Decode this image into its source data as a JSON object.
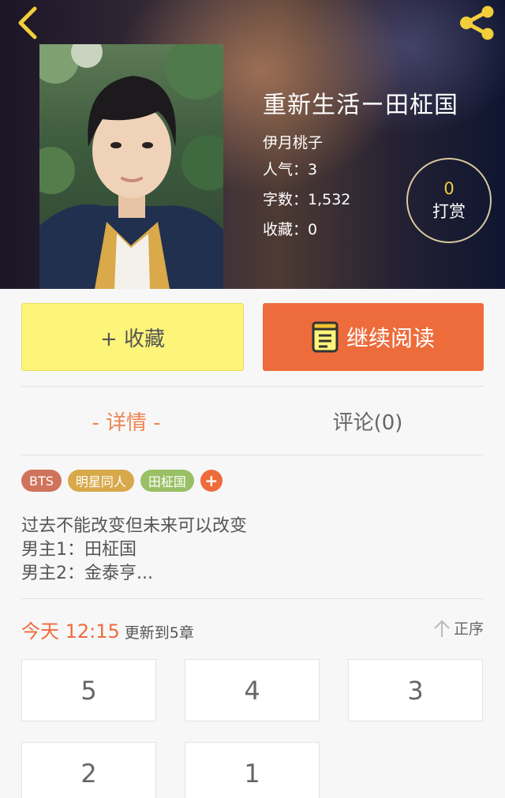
{
  "header": {
    "back_icon": "chevron-left-icon",
    "share_icon": "share-icon",
    "accent_color": "#f2cf3a"
  },
  "book": {
    "title": "重新生活ー田柾国",
    "author": "伊月桃子",
    "popularity": "人气：3",
    "word_count": "字数：1,532",
    "favorites": "收藏：0"
  },
  "reward": {
    "count": "0",
    "label": "打赏"
  },
  "actions": {
    "collect_label": "+ 收藏",
    "read_label": "继续阅读",
    "read_icon": "book-icon"
  },
  "tabs": {
    "details": "- 详情 -",
    "comments": "评论(0)"
  },
  "tags": [
    {
      "label": "BTS",
      "color": "#d0735c"
    },
    {
      "label": "明星同人",
      "color": "#d8a94a"
    },
    {
      "label": "田柾国",
      "color": "#9ac065"
    }
  ],
  "tag_add_label": "+",
  "description": {
    "line1": "过去不能改变但未来可以改变",
    "line2": "男主1：田柾国",
    "line3": "男主2：金泰亨..."
  },
  "update": {
    "time": "今天 12:15",
    "text": "更新到5章",
    "sort_label": "正序",
    "sort_icon": "arrow-up-icon"
  },
  "chapters": [
    "5",
    "4",
    "3",
    "2",
    "1"
  ]
}
